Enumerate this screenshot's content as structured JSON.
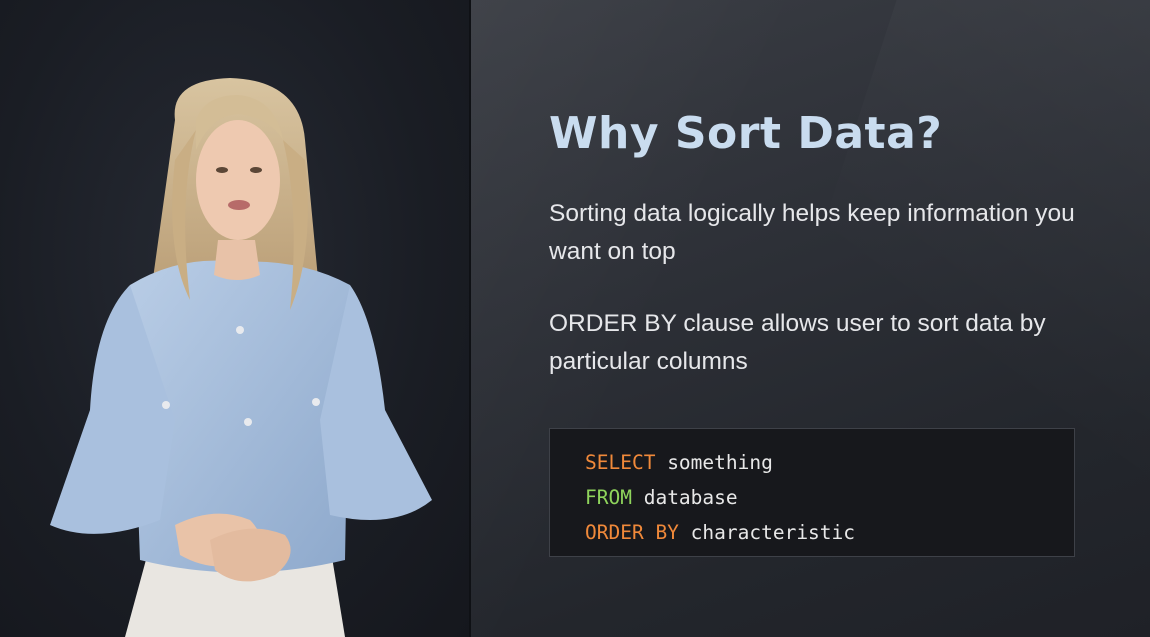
{
  "slide": {
    "title": "Why Sort Data?",
    "bullets": [
      "Sorting data logically helps keep information you want on top",
      "ORDER BY clause allows user to sort data by particular columns"
    ],
    "code": [
      {
        "keyword": "SELECT",
        "rest": " something",
        "keyword_color": "#f0893a"
      },
      {
        "keyword": "FROM",
        "rest": " database",
        "keyword_color": "#8fd45c"
      },
      {
        "keyword": "ORDER BY",
        "rest": " characteristic",
        "keyword_color": "#f0893a"
      }
    ]
  },
  "colors": {
    "title": "#c9dcef",
    "text": "#e6e7ea",
    "code_bg": "#17181c"
  }
}
